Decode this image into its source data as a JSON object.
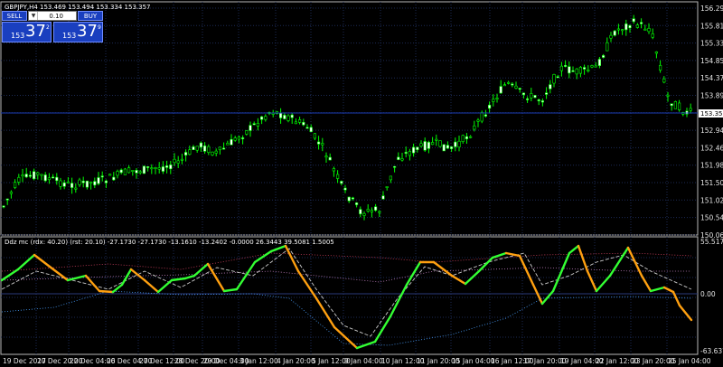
{
  "chart": {
    "header": "GBPJPY,H4  153.469 153.494 153.334 153.357",
    "current_price": "153.357",
    "price_axis": [
      "156.290",
      "155.810",
      "155.330",
      "154.850",
      "154.370",
      "153.890",
      "153.410",
      "152.940",
      "152.460",
      "151.980",
      "151.500",
      "151.020",
      "150.540",
      "150.060"
    ],
    "time_axis": [
      "19 Dec 2017",
      "20 Dec 20:00",
      "22 Dec 04:00",
      "26 Dec 04:00",
      "27 Dec 12:00",
      "28 Dec 20:00",
      "29 Dec 04:00",
      "3 Jan 12:00",
      "4 Jan 20:00",
      "5 Jan 12:00",
      "9 Jan 04:00",
      "10 Jan 12:00",
      "11 Jan 20:00",
      "15 Jan 04:00",
      "16 Jan 12:00",
      "17 Jan 20:00",
      "19 Jan 04:00",
      "22 Jan 12:00",
      "23 Jan 20:00",
      "25 Jan 04:00",
      "26 Jan 12:00",
      "29 Jan 20:00"
    ],
    "colors": {
      "bull": "#ffffff",
      "bear": "#ffffff",
      "wick": "#00ff00",
      "grid": "#1c2a55",
      "price_line": "#1c3db5"
    }
  },
  "indicator": {
    "header": "Ddz mc (rdx: 40.20) (rst: 20.10) -27.1730 -27.1730 -13.1610 -13.2402 -0.0000 26.3443 39.5081 1.5005",
    "axis": [
      "55.5177",
      "0.00",
      "-63.6377"
    ],
    "colors": {
      "up": "#33ff33",
      "down": "#ffa010",
      "dash": "#cccccc"
    }
  },
  "trade_panel": {
    "sell_label": "SELL",
    "buy_label": "BUY",
    "lot": "0.10",
    "sell_price_prefix": "153",
    "sell_price_main": "37",
    "sell_price_sup": "2",
    "buy_price_prefix": "153",
    "buy_price_main": "37",
    "buy_price_sup": "9",
    "dropdown_icon": "chevron-down-icon"
  }
}
